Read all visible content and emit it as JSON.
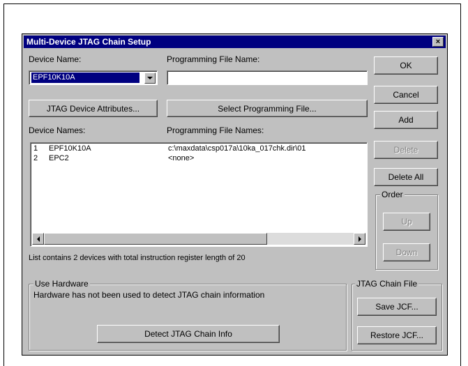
{
  "dialog": {
    "title": "Multi-Device JTAG Chain Setup",
    "close_label": "×"
  },
  "labels": {
    "device_name": "Device Name:",
    "programming_file_name": "Programming File Name:",
    "device_names": "Device Names:",
    "programming_file_names": "Programming File Names:",
    "summary": "List contains 2 devices with total instruction register length of 20"
  },
  "device_select": {
    "value": "EPF10K10A"
  },
  "programming_file_input": {
    "value": ""
  },
  "buttons": {
    "jtag_attributes": "JTAG Device Attributes...",
    "select_programming_file": "Select Programming File...",
    "ok": "OK",
    "cancel": "Cancel",
    "add": "Add",
    "delete": "Delete",
    "delete_all": "Delete All",
    "up": "Up",
    "down": "Down",
    "detect": "Detect JTAG Chain Info",
    "save_jcf": "Save JCF...",
    "restore_jcf": "Restore JCF..."
  },
  "device_list": [
    {
      "index": "1",
      "device": "EPF10K10A",
      "file": "c:\\maxdata\\csp017a\\10ka_017chk.dir\\01"
    },
    {
      "index": "2",
      "device": "EPC2",
      "file": "<none>"
    }
  ],
  "groups": {
    "order": "Order",
    "use_hardware": "Use Hardware",
    "jtag_chain_file": "JTAG Chain File"
  },
  "hardware_status": "Hardware has not been used to detect JTAG chain information"
}
